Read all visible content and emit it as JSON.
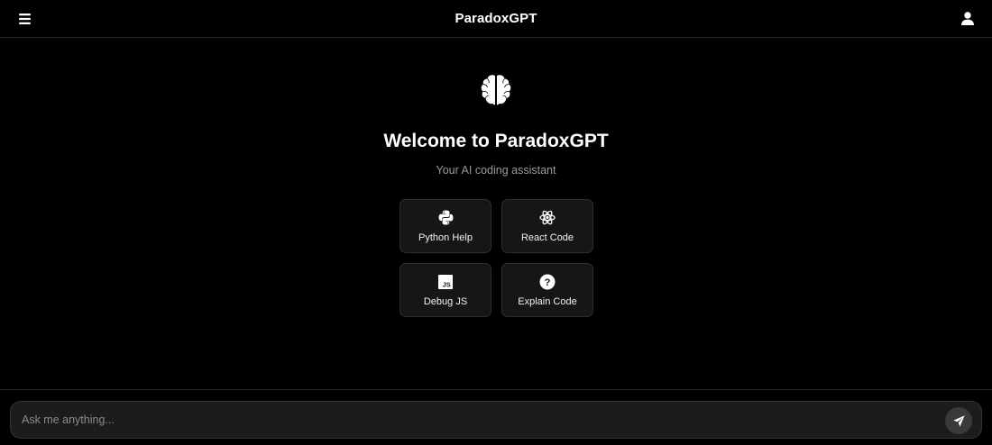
{
  "header": {
    "title": "ParadoxGPT",
    "menu_icon": "hamburger-menu-icon",
    "user_icon": "user-icon"
  },
  "welcome": {
    "icon": "brain-icon",
    "title": "Welcome to ParadoxGPT",
    "subtitle": "Your AI coding assistant"
  },
  "suggestions": [
    {
      "label": "Python Help",
      "icon": "python-icon"
    },
    {
      "label": "React Code",
      "icon": "react-icon"
    },
    {
      "label": "Debug JS",
      "icon": "javascript-icon"
    },
    {
      "label": "Explain Code",
      "icon": "question-circle-icon"
    }
  ],
  "composer": {
    "placeholder": "Ask me anything...",
    "value": "",
    "send_icon": "paper-plane-icon"
  },
  "colors": {
    "background": "#000000",
    "card_background": "#161616",
    "input_background": "#1c1c1c",
    "send_button": "#3a3a3a",
    "muted_text": "#9a9a9a"
  }
}
